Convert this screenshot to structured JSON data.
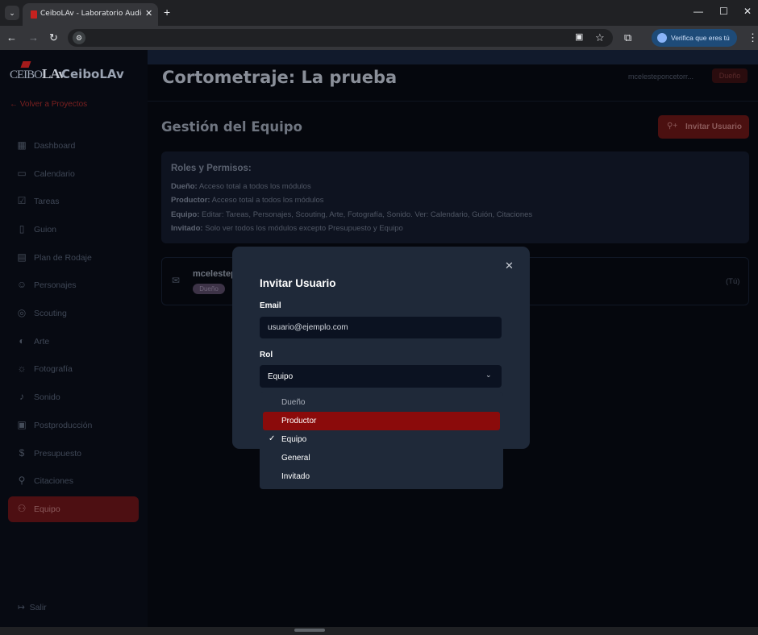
{
  "browser": {
    "tab_title": "CeiboLAv - Laboratorio Audiovisual",
    "tab_close": "✕",
    "new_tab": "+",
    "profile_label": "Verifica que eres tú"
  },
  "sidebar": {
    "logo_ceibo": "CEIBO",
    "logo_lav": "LAv",
    "app_name": "CeiboLAv",
    "back_link": "← Volver a Proyectos",
    "items": [
      {
        "label": "Dashboard",
        "icon": "▦"
      },
      {
        "label": "Calendario",
        "icon": "▭"
      },
      {
        "label": "Tareas",
        "icon": "☑"
      },
      {
        "label": "Guion",
        "icon": "▯"
      },
      {
        "label": "Plan de Rodaje",
        "icon": "▤"
      },
      {
        "label": "Personajes",
        "icon": "☺"
      },
      {
        "label": "Scouting",
        "icon": "◎"
      },
      {
        "label": "Arte",
        "icon": "◐"
      },
      {
        "label": "Fotografía",
        "icon": "☼"
      },
      {
        "label": "Sonido",
        "icon": "♪"
      },
      {
        "label": "Postproducción",
        "icon": "▣"
      },
      {
        "label": "Presupuesto",
        "icon": "$"
      },
      {
        "label": "Citaciones",
        "icon": "⚲"
      },
      {
        "label": "Equipo",
        "icon": "⚇"
      }
    ],
    "logout": "Salir"
  },
  "header": {
    "title": "Cortometraje: La prueba",
    "user_name": "mcelesteponcetorr...",
    "user_role": "Dueño"
  },
  "team": {
    "title": "Gestión del Equipo",
    "invite_button": "Invitar Usuario",
    "roles_title": "Roles y Permisos:",
    "roles": [
      {
        "name": "Dueño:",
        "desc": " Acceso total a todos los módulos"
      },
      {
        "name": "Productor:",
        "desc": " Acceso total a todos los módulos"
      },
      {
        "name": "Equipo:",
        "desc": " Editar: Tareas, Personajes, Scouting, Arte, Fotografía, Sonido. Ver: Calendario, Guión, Citaciones"
      },
      {
        "name": "Invitado:",
        "desc": " Solo ver todos los módulos excepto Presupuesto y Equipo"
      }
    ],
    "member": {
      "name": "mcelestep",
      "badge": "Dueño",
      "you": "(Tú)"
    }
  },
  "modal": {
    "title": "Invitar Usuario",
    "email_label": "Email",
    "email_placeholder": "usuario@ejemplo.com",
    "rol_label": "Rol",
    "rol_value": "Equipo",
    "options": [
      "Dueño",
      "Productor",
      "Equipo",
      "General",
      "Invitado"
    ],
    "selected": "Equipo",
    "highlighted": "Productor"
  },
  "colors": {
    "accent": "#8b0b0b",
    "modal_bg": "#1f2939",
    "input_bg": "#0b1221"
  }
}
